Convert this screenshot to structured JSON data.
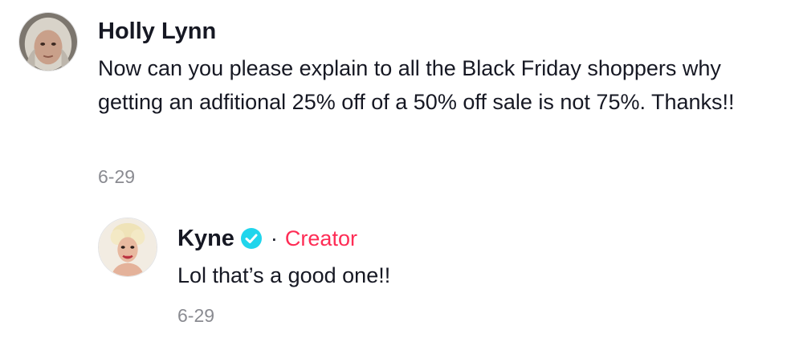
{
  "comment": {
    "author": "Holly Lynn",
    "text": "Now can you please explain to all the Black Friday shoppers why getting an adfitional 25% off of a 50% off sale is not 75%. Thanks!!",
    "date": "6-29",
    "avatar_icon": "user-avatar-photo"
  },
  "reply": {
    "author": "Kyne",
    "verified_icon": "verified-check-icon",
    "separator": "·",
    "role": "Creator",
    "text": "Lol that’s a good one!!",
    "date": "6-29",
    "avatar_icon": "creator-avatar-photo"
  },
  "colors": {
    "text": "#161823",
    "muted": "#8a8b91",
    "creator": "#fe2c55",
    "verified": "#20d5ec"
  }
}
